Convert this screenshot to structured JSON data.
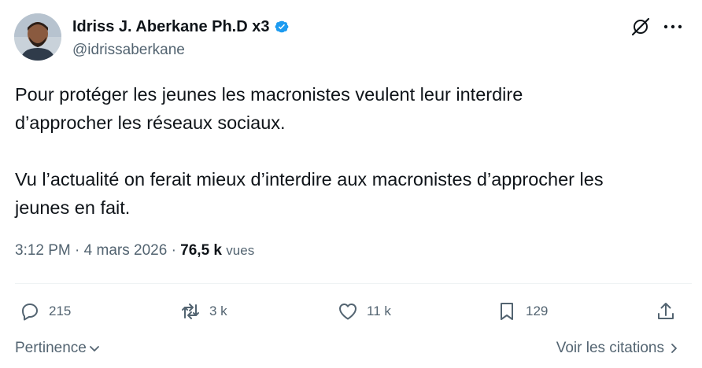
{
  "tweet": {
    "author": {
      "display_name": "Idriss J. Aberkane Ph.D x3",
      "handle": "@idrissaberkane",
      "verified_color": "#1d9bf0"
    },
    "text": "Pour protéger les jeunes les macronistes veulent leur interdire\nd’approcher les réseaux sociaux.\n\nVu l’actualité on ferait mieux d’interdire aux macronistes d’approcher les\njeunes en fait.",
    "time": "3:12 PM",
    "date": "4 mars 2026",
    "separator": "·",
    "views_count": "76,5 k",
    "views_label": "vues"
  },
  "actions": {
    "reply_count": "215",
    "retweet_count": "3 k",
    "like_count": "11 k",
    "bookmark_count": "129"
  },
  "footer": {
    "sort_label": "Pertinence",
    "quotes_label": "Voir les citations"
  },
  "icons": [
    "grok-icon",
    "more-icon",
    "reply-icon",
    "retweet-icon",
    "like-icon",
    "bookmark-icon",
    "share-icon",
    "chevron-down-icon",
    "chevron-right-icon",
    "verified-badge-icon"
  ]
}
